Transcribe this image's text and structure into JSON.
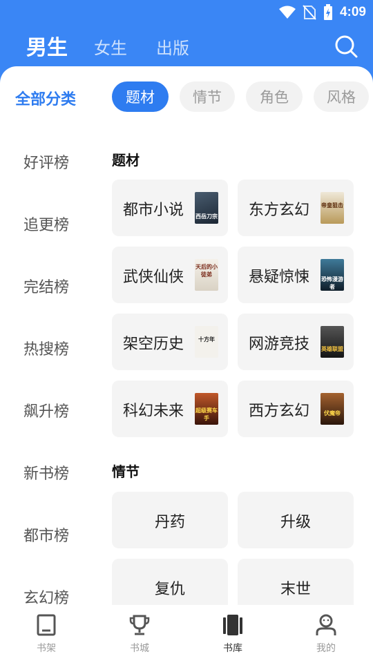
{
  "status": {
    "time": "4:09"
  },
  "header": {
    "tabs": [
      {
        "label": "男生",
        "active": true
      },
      {
        "label": "女生",
        "active": false
      },
      {
        "label": "出版",
        "active": false
      }
    ]
  },
  "filters": {
    "all_label": "全部分类",
    "chips": [
      {
        "label": "题材",
        "active": true
      },
      {
        "label": "情节",
        "active": false
      },
      {
        "label": "角色",
        "active": false
      },
      {
        "label": "风格",
        "active": false
      }
    ]
  },
  "rank_list": [
    "好评榜",
    "追更榜",
    "完结榜",
    "热搜榜",
    "飙升榜",
    "新书榜",
    "都市榜",
    "玄幻榜"
  ],
  "sections": [
    {
      "title": "题材",
      "items": [
        {
          "label": "都市小说",
          "cover_text": "西岳刀宗",
          "cover_color": "#2b3a4a"
        },
        {
          "label": "东方玄幻",
          "cover_text": "帝皇狙击",
          "cover_color": "#c9b48a"
        },
        {
          "label": "武侠仙侠",
          "cover_text": "天后的小徒弟",
          "cover_color": "#e9e2d6"
        },
        {
          "label": "悬疑惊悚",
          "cover_text": "恐怖漫游者",
          "cover_color": "#1c3346"
        },
        {
          "label": "架空历史",
          "cover_text": "十方年",
          "cover_color": "#f1efe9"
        },
        {
          "label": "网游竞技",
          "cover_text": "英雄联盟",
          "cover_color": "#26282b"
        },
        {
          "label": "科幻未来",
          "cover_text": "超级赛车手",
          "cover_color": "#7a2e1d"
        },
        {
          "label": "西方玄幻",
          "cover_text": "伏魔帝",
          "cover_color": "#6b3b22"
        }
      ]
    },
    {
      "title": "情节",
      "items": [
        {
          "label": "丹药"
        },
        {
          "label": "升级"
        },
        {
          "label": "复仇"
        },
        {
          "label": "末世"
        }
      ]
    }
  ],
  "bottom_nav": [
    {
      "label": "书架",
      "icon": "bookshelf-icon",
      "active": false
    },
    {
      "label": "书城",
      "icon": "trophy-icon",
      "active": false
    },
    {
      "label": "书库",
      "icon": "library-icon",
      "active": true
    },
    {
      "label": "我的",
      "icon": "profile-icon",
      "active": false
    }
  ],
  "colors": {
    "accent": "#2e7cf0",
    "header_bg": "#3a86f5"
  }
}
